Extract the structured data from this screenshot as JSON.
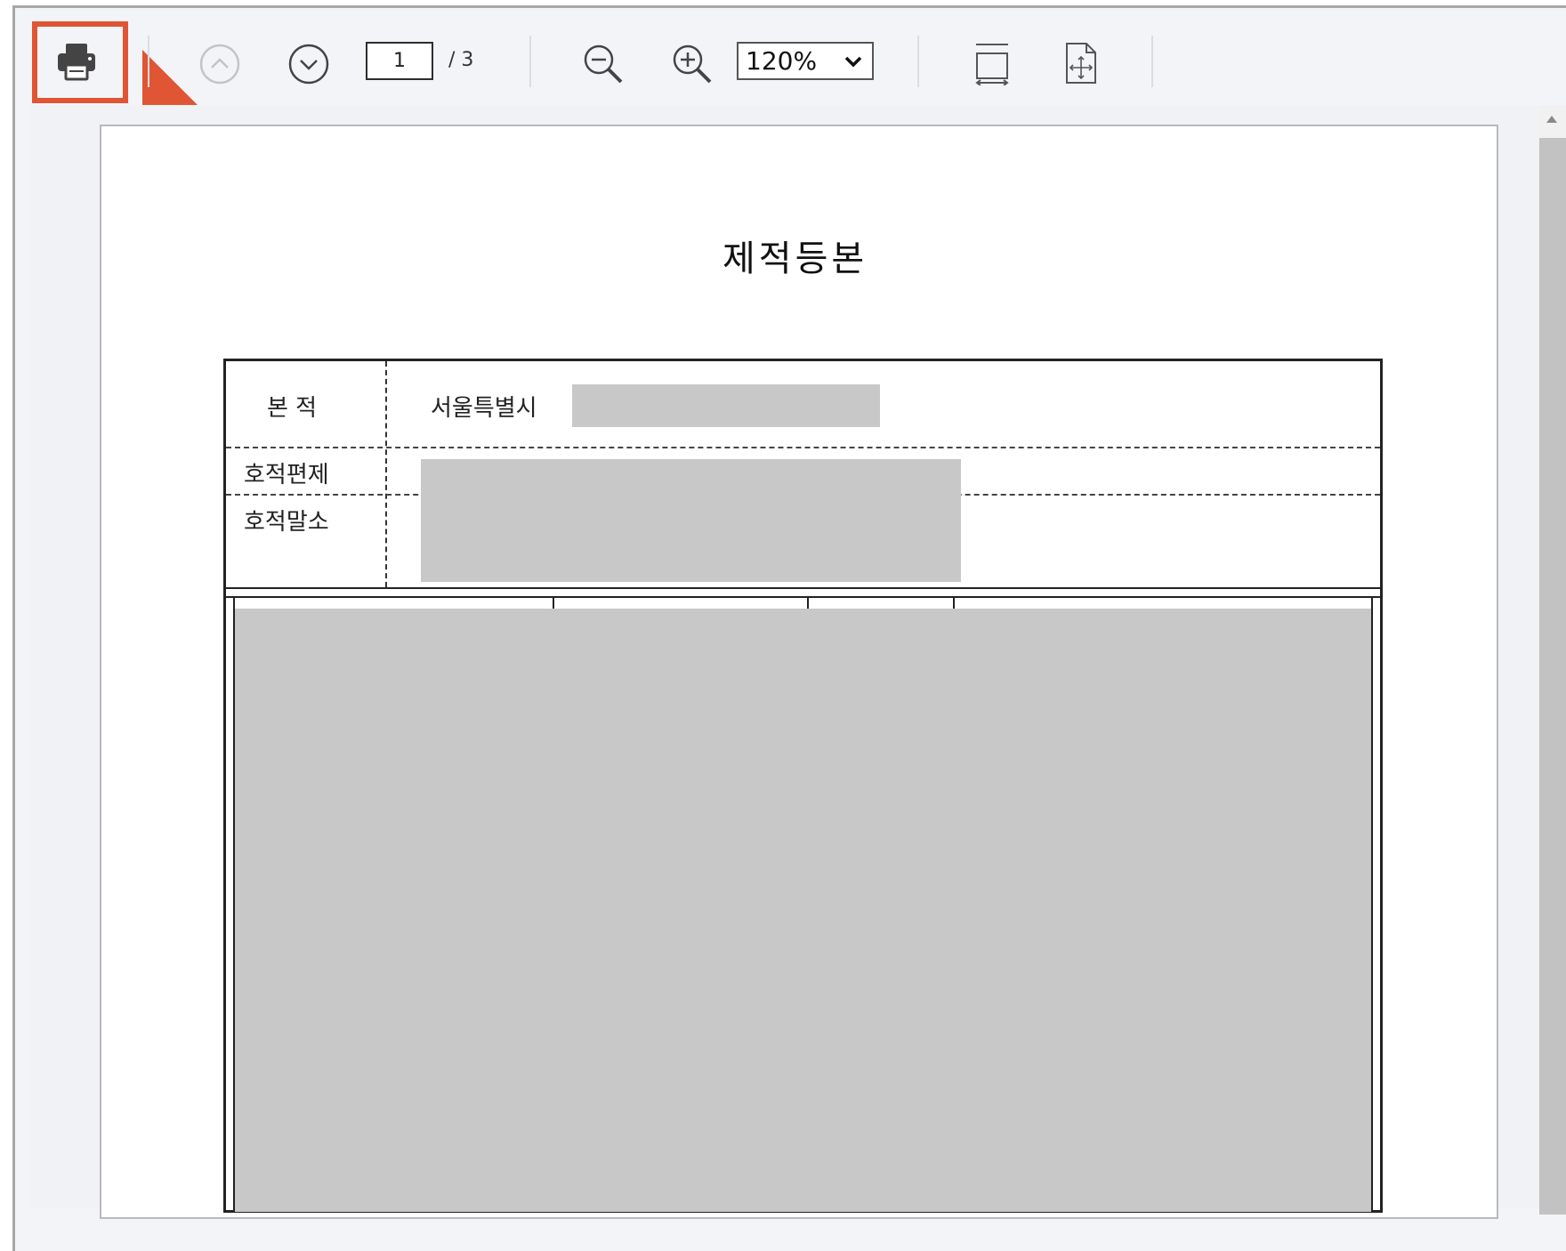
{
  "toolbar": {
    "print_icon": "printer-icon",
    "prev_page_icon": "chevron-up-circle-icon",
    "next_page_icon": "chevron-down-circle-icon",
    "current_page": "1",
    "total_pages": "/ 3",
    "zoom_out_icon": "zoom-out-icon",
    "zoom_in_icon": "zoom-in-icon",
    "zoom_value": "120%",
    "fit_width_icon": "fit-width-icon",
    "fit_page_icon": "fit-page-icon"
  },
  "document": {
    "title": "제적등본",
    "fields": {
      "bonjeok_label": "본    적",
      "bonjeok_value": "서울특별시",
      "hojeok_pyeonje_label": "호적편제",
      "hojeok_malso_label": "호적말소"
    }
  },
  "colors": {
    "highlight": "#e05534",
    "redaction": "#c8c8c8",
    "toolbar_bg": "#f3f4f8"
  }
}
